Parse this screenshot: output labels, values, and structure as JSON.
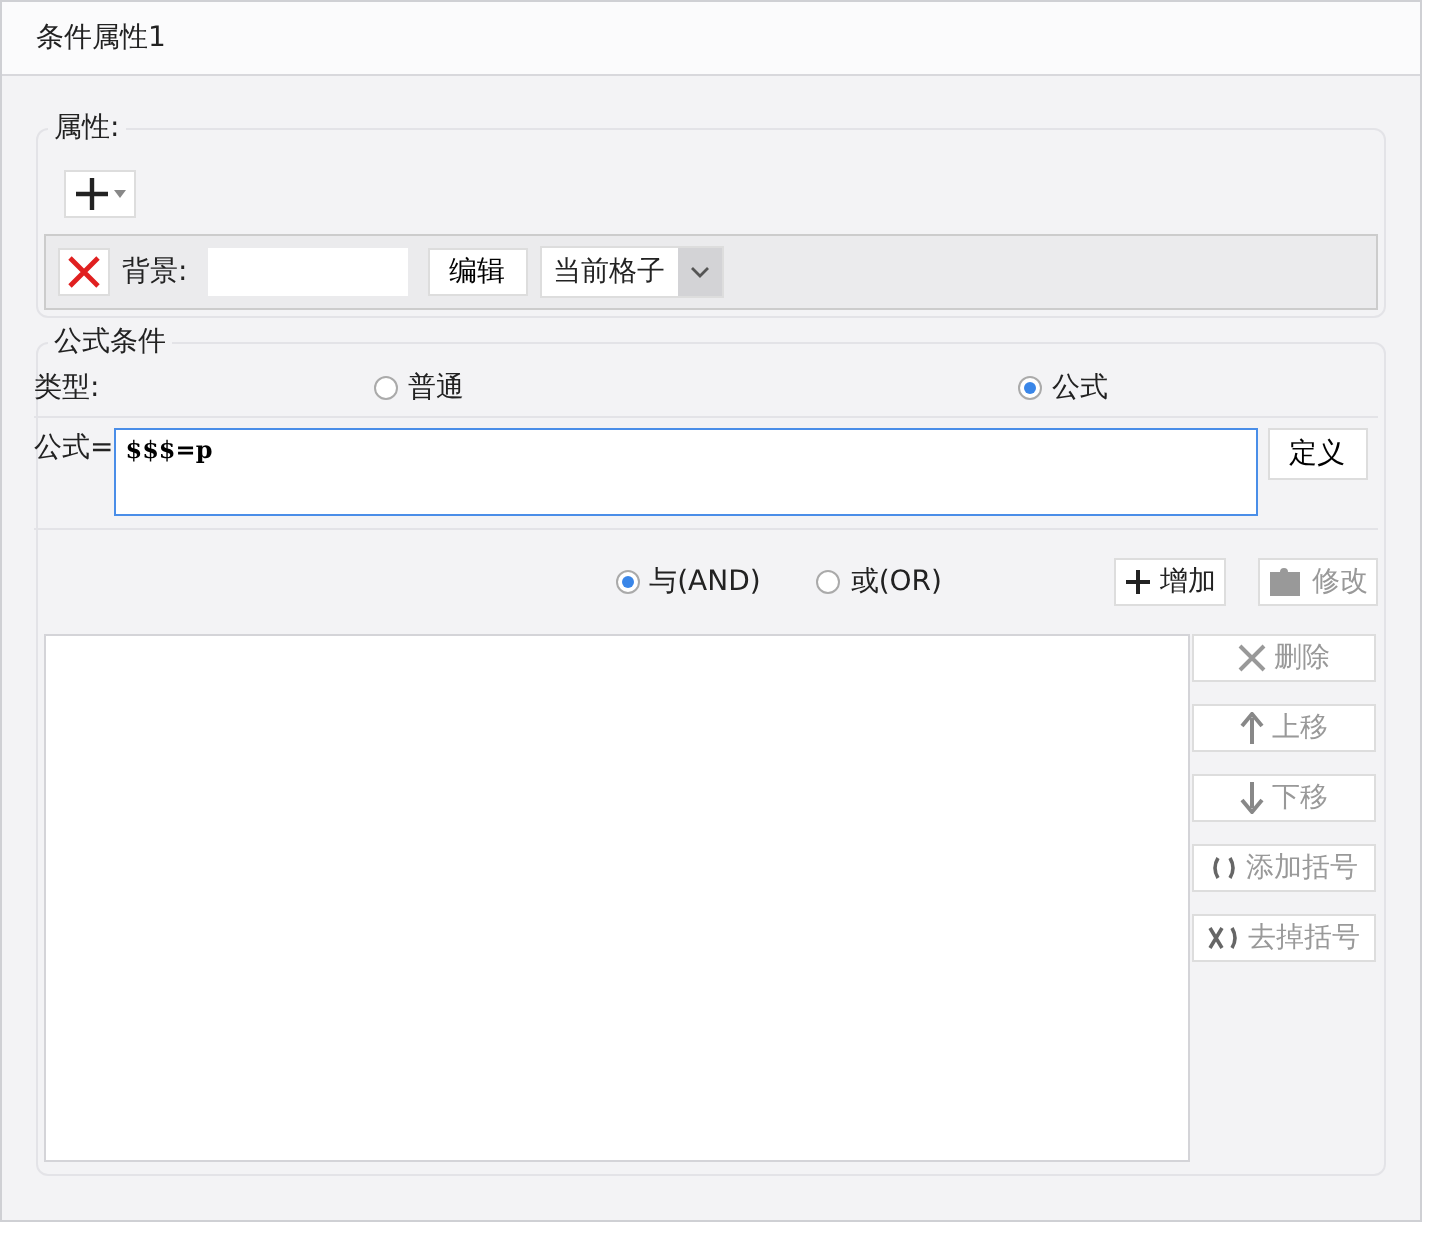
{
  "window": {
    "title": "条件属性1"
  },
  "properties": {
    "legend": "属性:",
    "background_label": "背景:",
    "edit_button": "编辑",
    "scope_dropdown": "当前格子"
  },
  "formula_condition": {
    "legend": "公式条件",
    "type_label": "类型:",
    "type_options": [
      {
        "label": "普通",
        "selected": false
      },
      {
        "label": "公式",
        "selected": true
      }
    ],
    "formula_label": "公式=",
    "formula_value": "$$$=p",
    "define_button": "定义"
  },
  "logic_options": [
    {
      "label": "与(AND)",
      "selected": true
    },
    {
      "label": "或(OR)",
      "selected": false
    }
  ],
  "top_buttons": [
    {
      "kind": "add",
      "label": "增加",
      "disabled": false
    },
    {
      "kind": "modify",
      "label": "修改",
      "disabled": true
    }
  ],
  "side_buttons": [
    {
      "kind": "delete",
      "label": "删除",
      "disabled": true
    },
    {
      "kind": "up",
      "label": "上移",
      "disabled": true
    },
    {
      "kind": "down",
      "label": "下移",
      "disabled": true
    },
    {
      "kind": "add_brackets",
      "label": "添加括号",
      "disabled": true
    },
    {
      "kind": "remove_brackets",
      "label": "去掉括号",
      "disabled": true
    }
  ]
}
